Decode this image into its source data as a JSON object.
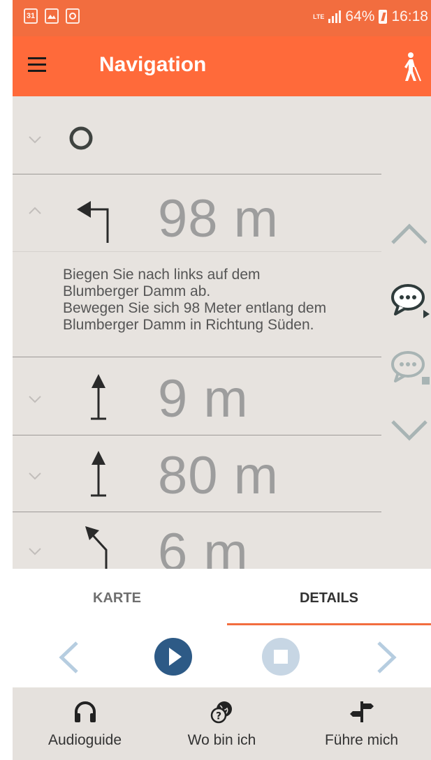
{
  "status_bar": {
    "icons": [
      "calendar-icon",
      "image-icon",
      "voicemail-icon"
    ],
    "calendar_day": "31",
    "network": "LTE",
    "battery": "64%",
    "time": "16:18"
  },
  "app_bar": {
    "title": "Navigation",
    "menu_icon": "hamburger-menu-icon",
    "mode_icon": "blind-walker-icon"
  },
  "steps": [
    {
      "direction": "destination-circle",
      "distance": "",
      "expanded": false
    },
    {
      "direction": "turn-left",
      "distance": "98 m",
      "expanded": true,
      "instruction": "Biegen Sie nach links auf dem\nBlumberger Damm ab.\nBewegen Sie sich 98 Meter entlang dem\nBlumberger Damm in Richtung Süden."
    },
    {
      "direction": "straight",
      "distance": "9 m",
      "expanded": false
    },
    {
      "direction": "straight",
      "distance": "80 m",
      "expanded": false
    },
    {
      "direction": "slight-left",
      "distance": "6 m",
      "expanded": false
    }
  ],
  "side_controls": [
    "scroll-up-icon",
    "speak-icon",
    "stop-speak-icon",
    "scroll-down-icon"
  ],
  "tabs": [
    {
      "label": "KARTE",
      "active": false
    },
    {
      "label": "DETAILS",
      "active": true
    }
  ],
  "player": {
    "controls": [
      "previous-icon",
      "play-icon",
      "stop-icon",
      "next-icon"
    ]
  },
  "bottom_nav": [
    {
      "label": "Audioguide",
      "icon": "headphones-icon"
    },
    {
      "label": "Wo bin ich",
      "icon": "globe-question-icon"
    },
    {
      "label": "Führe mich",
      "icon": "signpost-icon"
    }
  ],
  "colors": {
    "accent": "#ff6a3a",
    "status_bar": "#f26d3f",
    "content_bg": "#e7e3df",
    "play_blue": "#2d5a86",
    "side_icon": "#a8b4b4"
  }
}
